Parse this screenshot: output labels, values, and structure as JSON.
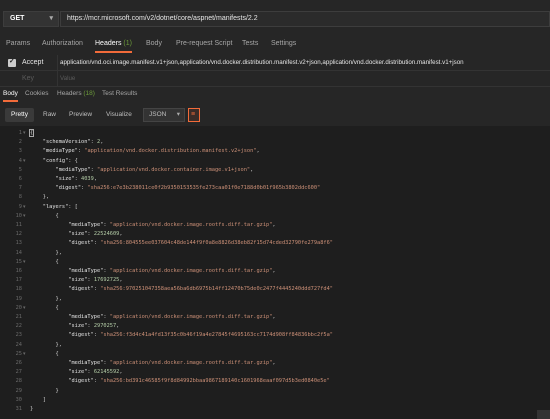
{
  "request": {
    "method": "GET",
    "url": "https://mcr.microsoft.com/v2/dotnet/core/aspnet/manifests/2.2"
  },
  "req_tabs": [
    {
      "label": "Params",
      "badge": ""
    },
    {
      "label": "Authorization",
      "badge": ""
    },
    {
      "label": "Headers",
      "badge": "(1)"
    },
    {
      "label": "Body",
      "badge": ""
    },
    {
      "label": "Pre-request Script",
      "badge": ""
    },
    {
      "label": "Tests",
      "badge": ""
    },
    {
      "label": "Settings",
      "badge": ""
    }
  ],
  "headers_table": {
    "row1": {
      "key": "Accept",
      "value": "application/vnd.oci.image.manifest.v1+json,application/vnd.docker.distribution.manifest.v2+json,application/vnd.docker.distribution.manifest.v1+json",
      "checked": true
    },
    "row2": {
      "key_placeholder": "Key",
      "value_placeholder": "Value"
    }
  },
  "resp_tabs": [
    {
      "label": "Body",
      "badge": ""
    },
    {
      "label": "Cookies",
      "badge": ""
    },
    {
      "label": "Headers",
      "badge": "(18)"
    },
    {
      "label": "Test Results",
      "badge": ""
    }
  ],
  "toolbar": {
    "pretty": "Pretty",
    "raw": "Raw",
    "preview": "Preview",
    "visualize": "Visualize",
    "format": "JSON",
    "wrap_icon": "wrap-lines-icon"
  },
  "code_lines": [
    [
      [
        "p",
        "{"
      ]
    ],
    [
      [
        "p",
        "    "
      ],
      [
        "k",
        "\"schemaVersion\""
      ],
      [
        "p",
        ": "
      ],
      [
        "n",
        "2"
      ],
      [
        "p",
        ","
      ]
    ],
    [
      [
        "p",
        "    "
      ],
      [
        "k",
        "\"mediaType\""
      ],
      [
        "p",
        ": "
      ],
      [
        "s",
        "\"application/vnd.docker.distribution.manifest.v2+json\""
      ],
      [
        "p",
        ","
      ]
    ],
    [
      [
        "p",
        "    "
      ],
      [
        "k",
        "\"config\""
      ],
      [
        "p",
        ": {"
      ]
    ],
    [
      [
        "p",
        "        "
      ],
      [
        "k",
        "\"mediaType\""
      ],
      [
        "p",
        ": "
      ],
      [
        "s",
        "\"application/vnd.docker.container.image.v1+json\""
      ],
      [
        "p",
        ","
      ]
    ],
    [
      [
        "p",
        "        "
      ],
      [
        "k",
        "\"size\""
      ],
      [
        "p",
        ": "
      ],
      [
        "n",
        "4039"
      ],
      [
        "p",
        ","
      ]
    ],
    [
      [
        "p",
        "        "
      ],
      [
        "k",
        "\"digest\""
      ],
      [
        "p",
        ": "
      ],
      [
        "s",
        "\"sha256:e7e3b238011ce0f2b9350153535fe273caa01f0e7188d0b01f965b3802ddc600\""
      ]
    ],
    [
      [
        "p",
        "    },"
      ]
    ],
    [
      [
        "p",
        "    "
      ],
      [
        "k",
        "\"layers\""
      ],
      [
        "p",
        ": ["
      ]
    ],
    [
      [
        "p",
        "        {"
      ]
    ],
    [
      [
        "p",
        "            "
      ],
      [
        "k",
        "\"mediaType\""
      ],
      [
        "p",
        ": "
      ],
      [
        "s",
        "\"application/vnd.docker.image.rootfs.diff.tar.gzip\""
      ],
      [
        "p",
        ","
      ]
    ],
    [
      [
        "p",
        "            "
      ],
      [
        "k",
        "\"size\""
      ],
      [
        "p",
        ": "
      ],
      [
        "n",
        "22524609"
      ],
      [
        "p",
        ","
      ]
    ],
    [
      [
        "p",
        "            "
      ],
      [
        "k",
        "\"digest\""
      ],
      [
        "p",
        ": "
      ],
      [
        "s",
        "\"sha256:804555ee037604c48de144f9f0a8e8826d38eb82f15d74cded32790fe279a8f6\""
      ]
    ],
    [
      [
        "p",
        "        },"
      ]
    ],
    [
      [
        "p",
        "        {"
      ]
    ],
    [
      [
        "p",
        "            "
      ],
      [
        "k",
        "\"mediaType\""
      ],
      [
        "p",
        ": "
      ],
      [
        "s",
        "\"application/vnd.docker.image.rootfs.diff.tar.gzip\""
      ],
      [
        "p",
        ","
      ]
    ],
    [
      [
        "p",
        "            "
      ],
      [
        "k",
        "\"size\""
      ],
      [
        "p",
        ": "
      ],
      [
        "n",
        "17692725"
      ],
      [
        "p",
        ","
      ]
    ],
    [
      [
        "p",
        "            "
      ],
      [
        "k",
        "\"digest\""
      ],
      [
        "p",
        ": "
      ],
      [
        "s",
        "\"sha256:970251047358aea56ba6db6975b14ff12470b75de0c2477f4445240ddd727fd4\""
      ]
    ],
    [
      [
        "p",
        "        },"
      ]
    ],
    [
      [
        "p",
        "        {"
      ]
    ],
    [
      [
        "p",
        "            "
      ],
      [
        "k",
        "\"mediaType\""
      ],
      [
        "p",
        ": "
      ],
      [
        "s",
        "\"application/vnd.docker.image.rootfs.diff.tar.gzip\""
      ],
      [
        "p",
        ","
      ]
    ],
    [
      [
        "p",
        "            "
      ],
      [
        "k",
        "\"size\""
      ],
      [
        "p",
        ": "
      ],
      [
        "n",
        "2970257"
      ],
      [
        "p",
        ","
      ]
    ],
    [
      [
        "p",
        "            "
      ],
      [
        "k",
        "\"digest\""
      ],
      [
        "p",
        ": "
      ],
      [
        "s",
        "\"sha256:f3d4c41a4fd13f35c0b46f19a4e27845f4695163cc7174d908ff84836bbc2f5a\""
      ]
    ],
    [
      [
        "p",
        "        },"
      ]
    ],
    [
      [
        "p",
        "        {"
      ]
    ],
    [
      [
        "p",
        "            "
      ],
      [
        "k",
        "\"mediaType\""
      ],
      [
        "p",
        ": "
      ],
      [
        "s",
        "\"application/vnd.docker.image.rootfs.diff.tar.gzip\""
      ],
      [
        "p",
        ","
      ]
    ],
    [
      [
        "p",
        "            "
      ],
      [
        "k",
        "\"size\""
      ],
      [
        "p",
        ": "
      ],
      [
        "n",
        "62145592"
      ],
      [
        "p",
        ","
      ]
    ],
    [
      [
        "p",
        "            "
      ],
      [
        "k",
        "\"digest\""
      ],
      [
        "p",
        ": "
      ],
      [
        "s",
        "\"sha256:bd391c46585f9f8d84992bbaa9867189140c1601968eaaf097d5b3ed0840e5e\""
      ]
    ],
    [
      [
        "p",
        "        }"
      ]
    ],
    [
      [
        "p",
        "    ]"
      ]
    ],
    [
      [
        "p",
        "}"
      ]
    ]
  ],
  "fold_lines": [
    1,
    4,
    9,
    10,
    15,
    20,
    25
  ],
  "colors": {
    "accent": "#f26b3a",
    "badge": "#6c9b3a",
    "string": "#ce9178",
    "number": "#b5cea8"
  }
}
